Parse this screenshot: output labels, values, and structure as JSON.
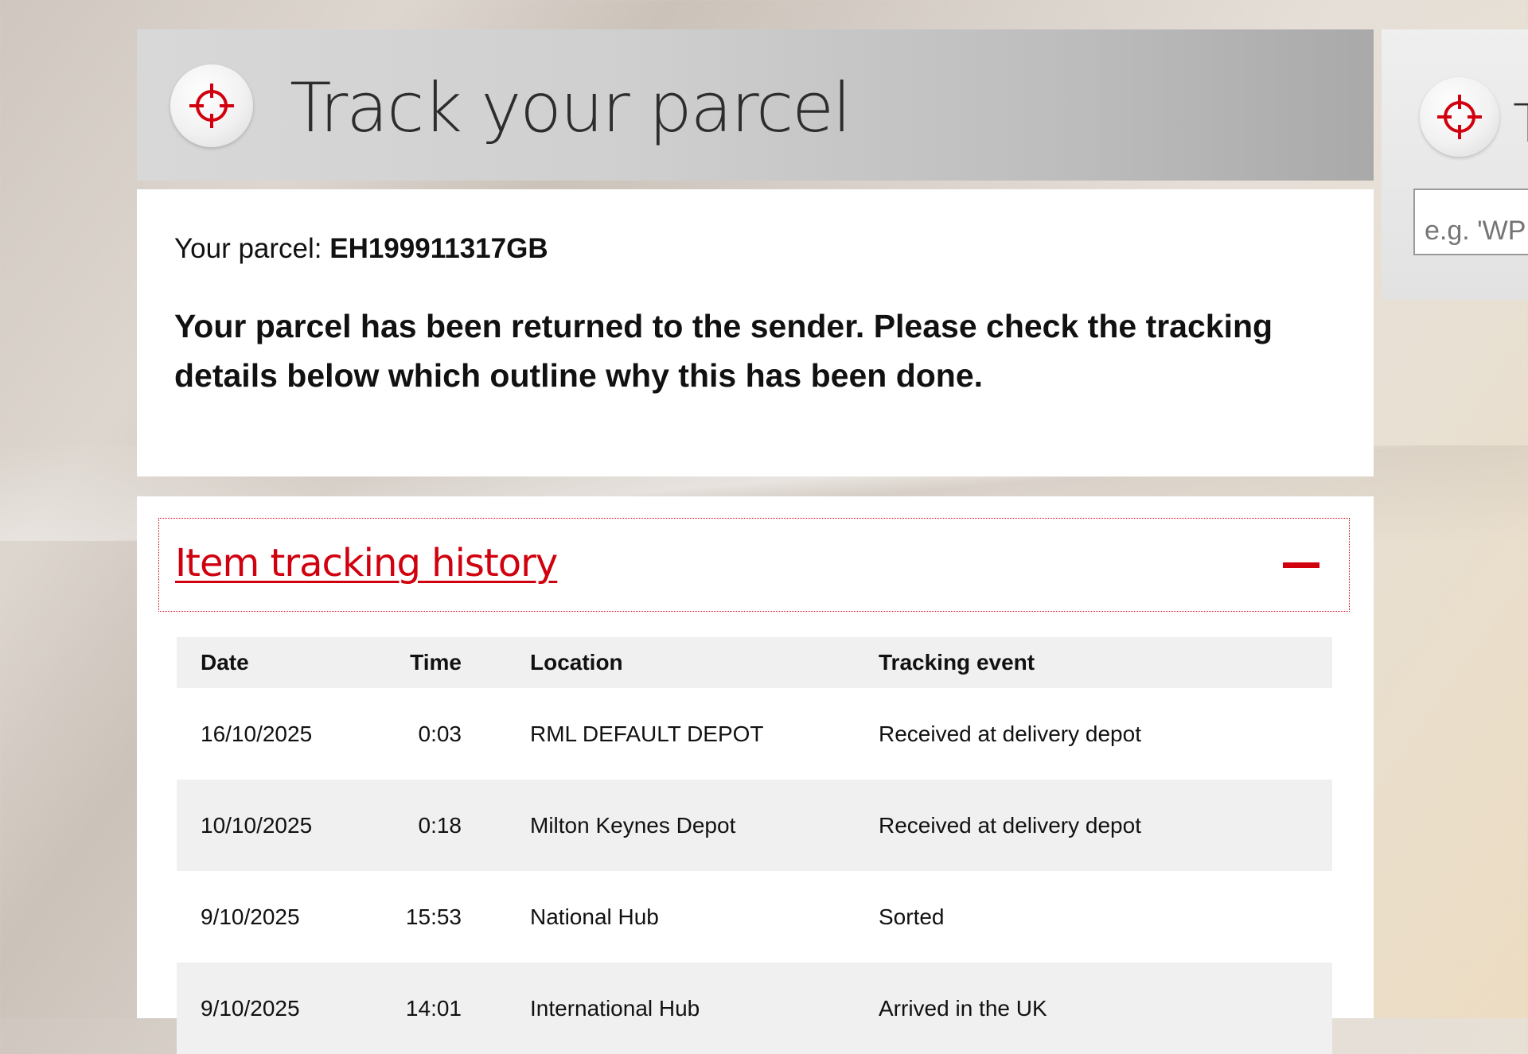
{
  "header": {
    "title": "Track your parcel",
    "icon": "crosshair-target-icon"
  },
  "status": {
    "parcel_label": "Your parcel: ",
    "parcel_number": "EH199911317GB",
    "message": "Your parcel has been returned to the sender. Please check the tracking details below which outline why this has been done."
  },
  "history": {
    "title": "Item tracking history",
    "toggle_icon": "collapse-minus-icon",
    "columns": [
      "Date",
      "Time",
      "Location",
      "Tracking event"
    ],
    "rows": [
      {
        "date": "16/10/2025",
        "time": "0:03",
        "location": "RML DEFAULT DEPOT",
        "event": "Received at delivery depot"
      },
      {
        "date": "10/10/2025",
        "time": "0:18",
        "location": "Milton Keynes Depot",
        "event": "Received at delivery depot"
      },
      {
        "date": "9/10/2025",
        "time": "15:53",
        "location": "National Hub",
        "event": "Sorted"
      },
      {
        "date": "9/10/2025",
        "time": "14:01",
        "location": "International Hub",
        "event": "Arrived in the UK"
      }
    ]
  },
  "side_panel": {
    "title_fragment": "T",
    "input_placeholder": "e.g. 'WP"
  },
  "colors": {
    "accent_red": "#d1000e",
    "header_gray": "#c4c4c4",
    "row_alt": "#f0f0f0"
  }
}
